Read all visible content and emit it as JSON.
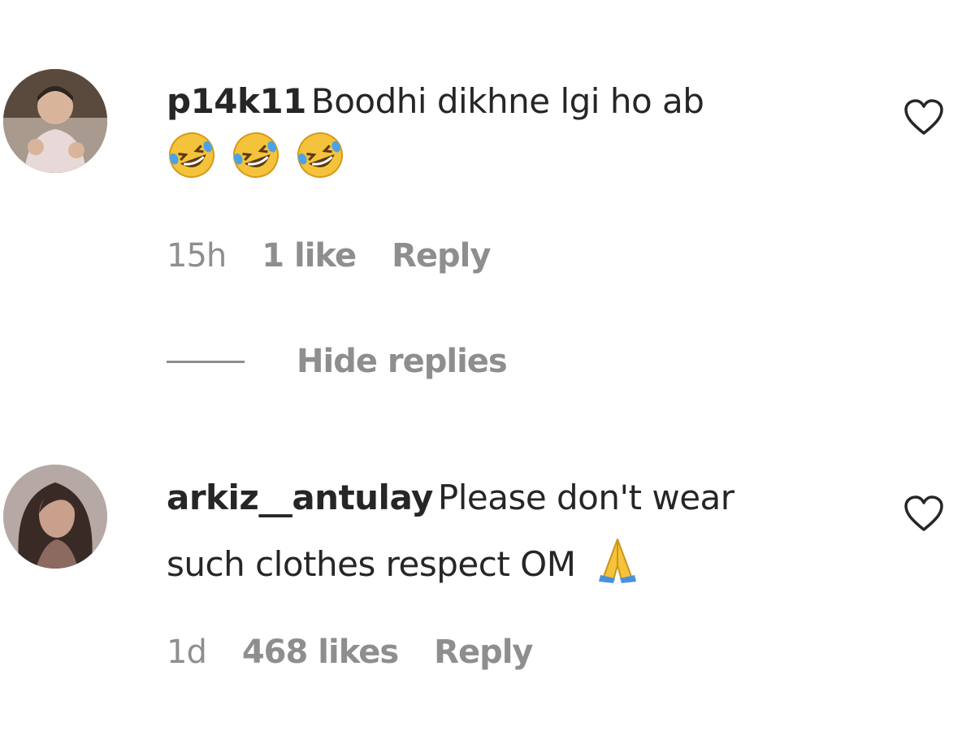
{
  "comments": [
    {
      "username": "p14k11",
      "text": "Boodhi dikhne lgi ho ab",
      "emojis": [
        "rolling-on-floor-laughing",
        "rolling-on-floor-laughing",
        "rolling-on-floor-laughing"
      ],
      "time": "15h",
      "likes": "1 like",
      "reply_label": "Reply"
    },
    {
      "username": "arkiz__antulay",
      "text_line1": "Please don't wear",
      "text_line2": "such clothes respect OM",
      "emojis": [
        "folded-hands"
      ],
      "time": "1d",
      "likes": "468 likes",
      "reply_label": "Reply"
    }
  ],
  "hide_replies_label": "Hide replies",
  "colors": {
    "text": "#262626",
    "secondary": "#8e8e8e",
    "emoji_yellow": "#f5c33b",
    "emoji_blue": "#4a90d9"
  },
  "icons": [
    "heart-outline-icon"
  ]
}
